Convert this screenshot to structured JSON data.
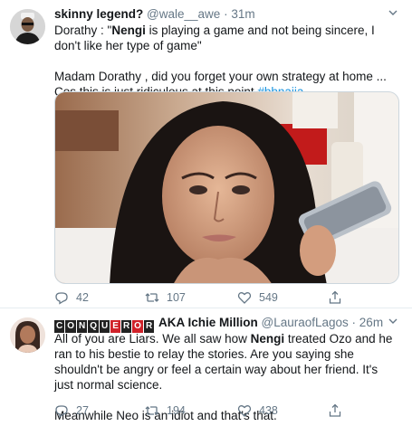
{
  "tweets": [
    {
      "name": "skinny legend?",
      "handle": "@wale__awe",
      "dot": "·",
      "time": "31m",
      "line1_pre": "Dorathy : \"",
      "line1_bold": "Nengi",
      "line1_post": " is playing a game and not being sincere, I don't like her type of game\"",
      "line2": "Madam Dorathy , did you forget your own strategy at home ... Cos this is just ridiculous at this point ",
      "hashtag": "#bbnaija",
      "replies": "42",
      "retweets": "107",
      "likes": "549"
    },
    {
      "name_flag_letters": [
        "C",
        "O",
        "N",
        "Q",
        "U",
        "E",
        "R",
        "O",
        "R"
      ],
      "name_rest": "AKA Ichie Million",
      "handle": "@LauraofLagos",
      "dot": "·",
      "time": "26m",
      "line1_pre": "All of you are Liars. We all saw how ",
      "line1_bold": "Nengi",
      "line1_post": " treated Ozo and he ran to his bestie to relay the stories. Are you saying she shouldn't be angry or feel a certain way about her friend. It's just normal science.",
      "line2": "Meanwhile Neo is an idiot and that's that.",
      "replies": "27",
      "retweets": "194",
      "likes": "438"
    }
  ],
  "icons": {
    "reply": "reply-icon",
    "retweet": "retweet-icon",
    "like": "heart-icon",
    "share": "share-icon",
    "menu": "chevron-down-icon"
  },
  "colors": {
    "link": "#1b95e0",
    "secondary": "#657786",
    "divider": "#e6ecf0"
  }
}
